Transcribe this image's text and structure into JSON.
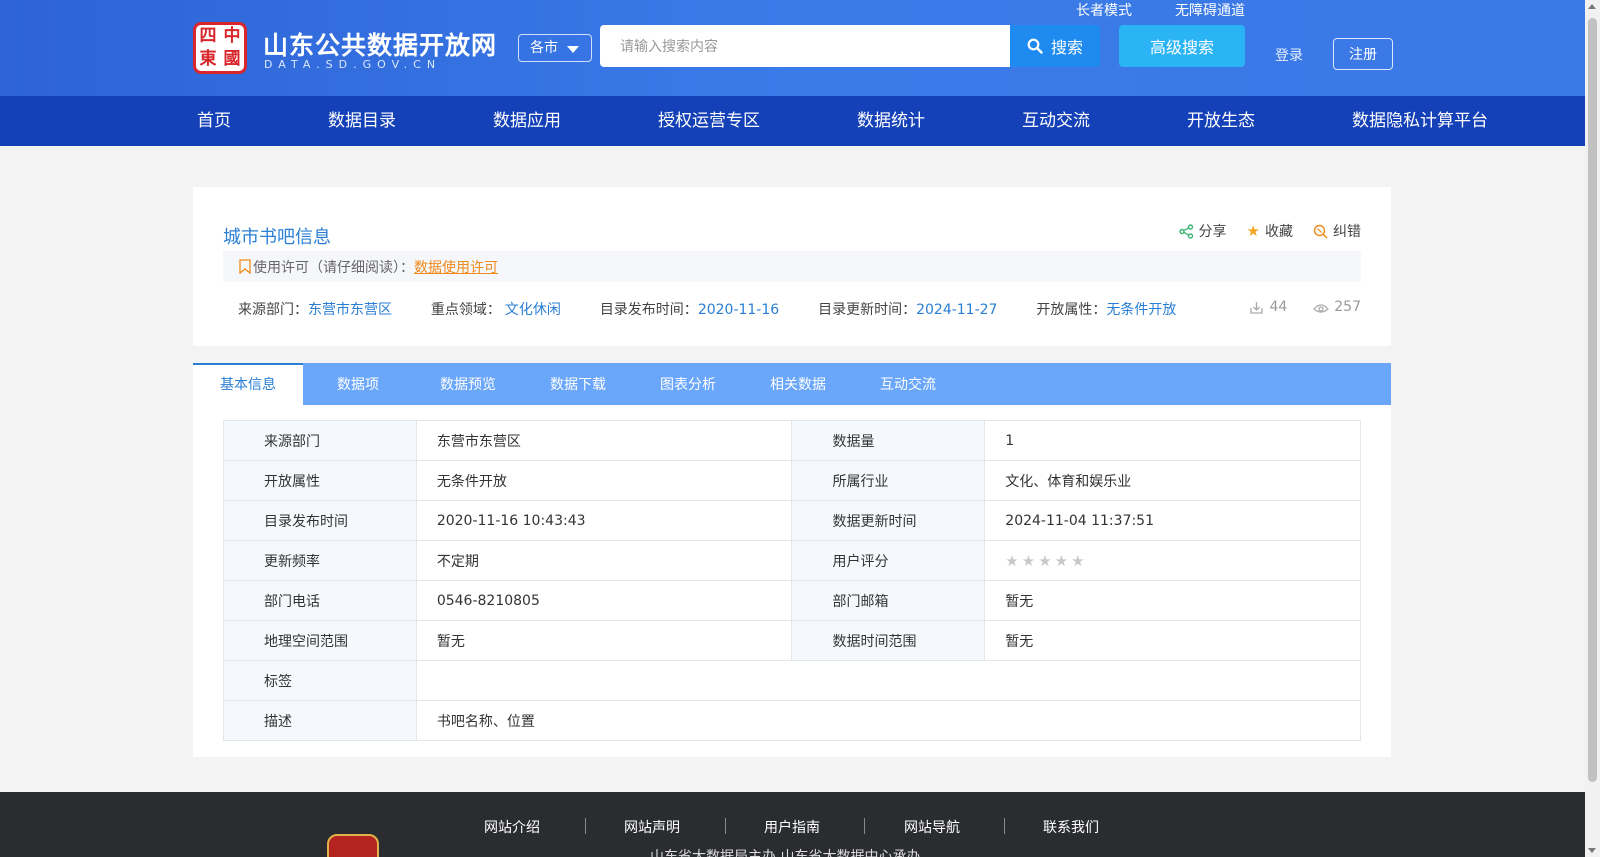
{
  "header": {
    "logo_chars": [
      "四",
      "中",
      "東",
      "國"
    ],
    "site_name": "山东公共数据开放网",
    "site_domain": "DATA.SD.GOV.CN",
    "city_select": "各市",
    "search_placeholder": "请输入搜索内容",
    "search_label": "搜索",
    "advanced_search_label": "高级搜索",
    "elder_mode": "长者模式",
    "accessibility": "无障碍通道",
    "login": "登录",
    "register": "注册"
  },
  "nav": {
    "items": [
      "首页",
      "数据目录",
      "数据应用",
      "授权运营专区",
      "数据统计",
      "互动交流",
      "开放生态",
      "数据隐私计算平台"
    ]
  },
  "dataset": {
    "title": "城市书吧信息",
    "actions": {
      "share": "分享",
      "favorite": "收藏",
      "correct": "纠错"
    },
    "license_label": "使用许可（请仔细阅读）：",
    "license_link": "数据使用许可",
    "meta": {
      "source_label": "来源部门：",
      "source": "东营市东营区",
      "domain_label": "重点领域：",
      "domain": "文化休闲",
      "publish_label": "目录发布时间：",
      "publish": "2020-11-16",
      "update_label": "目录更新时间：",
      "update": "2024-11-27",
      "open_label": "开放属性：",
      "open": "无条件开放"
    },
    "downloads": "44",
    "views": "257"
  },
  "tabs": [
    "基本信息",
    "数据项",
    "数据预览",
    "数据下载",
    "图表分析",
    "相关数据",
    "互动交流"
  ],
  "info_table": {
    "rows": [
      [
        "来源部门",
        "东营市东营区",
        "数据量",
        "1"
      ],
      [
        "开放属性",
        "无条件开放",
        "所属行业",
        "文化、体育和娱乐业"
      ],
      [
        "目录发布时间",
        "2020-11-16 10:43:43",
        "数据更新时间",
        "2024-11-04 11:37:51"
      ],
      [
        "更新频率",
        "不定期",
        "用户评分",
        ""
      ],
      [
        "部门电话",
        "0546-8210805",
        "部门邮箱",
        "暂无"
      ],
      [
        "地理空间范围",
        "暂无",
        "数据时间范围",
        "暂无"
      ]
    ],
    "tags_label": "标签",
    "tags_value": "",
    "desc_label": "描述",
    "desc_value": "书吧名称、位置",
    "rating": 0
  },
  "footer": {
    "links": [
      "网站介绍",
      "网站声明",
      "用户指南",
      "网站导航",
      "联系我们"
    ],
    "host": "山东省大数据局主办    山东省大数据中心承办"
  },
  "colors": {
    "header": "#2d63d6",
    "nav": "#1440b8",
    "accent": "#2a7fd4",
    "tab_bar": "#6aa6fa",
    "license": "#f08a1c"
  }
}
